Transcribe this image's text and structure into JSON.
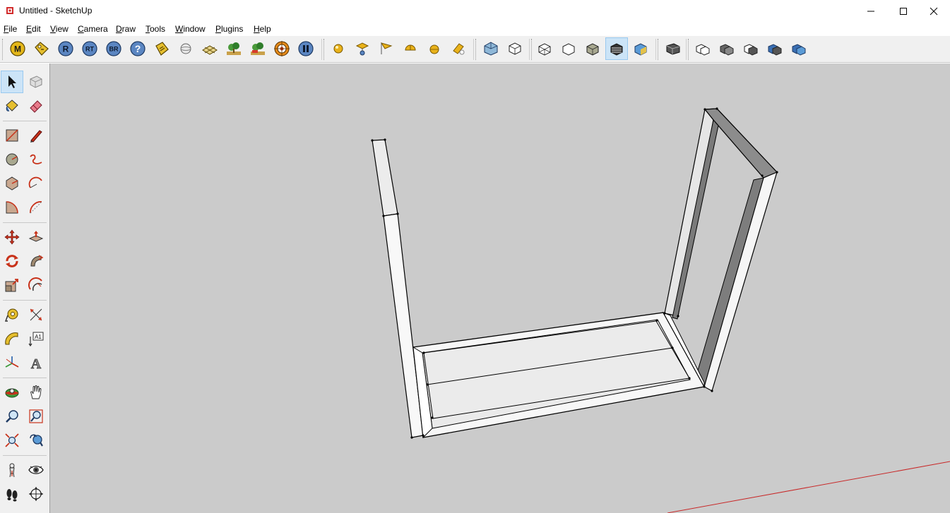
{
  "window": {
    "title": "Untitled - SketchUp",
    "controls": [
      "minimize-icon",
      "maximize-icon",
      "close-icon"
    ]
  },
  "menu": {
    "items": [
      {
        "label": "File",
        "mnemonic": "F"
      },
      {
        "label": "Edit",
        "mnemonic": "E"
      },
      {
        "label": "View",
        "mnemonic": "V"
      },
      {
        "label": "Camera",
        "mnemonic": "C"
      },
      {
        "label": "Draw",
        "mnemonic": "D"
      },
      {
        "label": "Tools",
        "mnemonic": "T"
      },
      {
        "label": "Window",
        "mnemonic": "W"
      },
      {
        "label": "Plugins",
        "mnemonic": "P"
      },
      {
        "label": "Help",
        "mnemonic": "H"
      }
    ]
  },
  "toolbar": {
    "plugin_buttons": [
      {
        "name": "plugin-m-icon",
        "glyph": "M"
      },
      {
        "name": "plugin-tag-icon",
        "glyph": ""
      },
      {
        "name": "plugin-r-icon",
        "glyph": "R"
      },
      {
        "name": "plugin-rt-icon",
        "glyph": "RT"
      },
      {
        "name": "plugin-br-icon",
        "glyph": "BR"
      },
      {
        "name": "plugin-help-icon",
        "glyph": "?"
      },
      {
        "name": "plugin-label-icon",
        "glyph": ""
      },
      {
        "name": "plugin-sphere-icon",
        "glyph": ""
      },
      {
        "name": "plugin-plane-icon",
        "glyph": ""
      },
      {
        "name": "plugin-tree-icon",
        "glyph": ""
      },
      {
        "name": "plugin-tree-red-icon",
        "glyph": ""
      },
      {
        "name": "plugin-target-icon",
        "glyph": ""
      },
      {
        "name": "plugin-pause-icon",
        "glyph": ""
      }
    ],
    "light_buttons": [
      "omni-light-icon",
      "spot-light-icon",
      "area-light-icon",
      "half-sphere-light-icon",
      "sphere-light-icon",
      "light-wand-icon"
    ],
    "view_buttons": [
      "iso-view-icon",
      "top-view-icon"
    ],
    "style_buttons": [
      {
        "name": "xray-style-icon",
        "active": false
      },
      {
        "name": "wireframe-style-icon",
        "active": false
      },
      {
        "name": "hidden-line-style-icon",
        "active": false
      },
      {
        "name": "shaded-style-icon",
        "active": false
      },
      {
        "name": "shaded-textures-style-icon",
        "active": true
      },
      {
        "name": "monochrome-style-icon",
        "active": false
      }
    ],
    "component_buttons": [
      "make-component-icon"
    ],
    "solid_buttons": [
      "outer-shell-icon",
      "intersect-icon",
      "union-icon",
      "subtract-icon",
      "trim-icon",
      "split-icon"
    ]
  },
  "palette": {
    "tools": [
      {
        "name": "select-tool-icon",
        "active": true
      },
      {
        "name": "make-component-tool-icon",
        "active": false
      },
      {
        "name": "paint-bucket-tool-icon",
        "active": false
      },
      {
        "name": "eraser-tool-icon",
        "active": false
      },
      {
        "name": "rectangle-tool-icon",
        "active": false
      },
      {
        "name": "line-tool-icon",
        "active": false
      },
      {
        "name": "circle-tool-icon",
        "active": false
      },
      {
        "name": "freehand-tool-icon",
        "active": false
      },
      {
        "name": "polygon-tool-icon",
        "active": false
      },
      {
        "name": "arc-tool-icon",
        "active": false
      },
      {
        "name": "pie-tool-icon",
        "active": false
      },
      {
        "name": "three-point-arc-tool-icon",
        "active": false
      },
      {
        "name": "move-tool-icon",
        "active": false
      },
      {
        "name": "push-pull-tool-icon",
        "active": false
      },
      {
        "name": "rotate-tool-icon",
        "active": false
      },
      {
        "name": "follow-me-tool-icon",
        "active": false
      },
      {
        "name": "scale-tool-icon",
        "active": false
      },
      {
        "name": "offset-tool-icon",
        "active": false
      },
      {
        "name": "tape-measure-tool-icon",
        "active": false
      },
      {
        "name": "dimension-tool-icon",
        "active": false
      },
      {
        "name": "protractor-tool-icon",
        "active": false
      },
      {
        "name": "text-tool-icon",
        "active": false,
        "glyph": "A1"
      },
      {
        "name": "axes-tool-icon",
        "active": false
      },
      {
        "name": "3d-text-tool-icon",
        "active": false,
        "glyph": "A"
      },
      {
        "name": "orbit-tool-icon",
        "active": false
      },
      {
        "name": "pan-tool-icon",
        "active": false
      },
      {
        "name": "zoom-tool-icon",
        "active": false
      },
      {
        "name": "zoom-window-tool-icon",
        "active": false
      },
      {
        "name": "zoom-extents-tool-icon",
        "active": false
      },
      {
        "name": "previous-view-tool-icon",
        "active": false
      },
      {
        "name": "position-camera-tool-icon",
        "active": false
      },
      {
        "name": "look-around-tool-icon",
        "active": false
      },
      {
        "name": "walk-tool-icon",
        "active": false
      },
      {
        "name": "section-plane-tool-icon",
        "active": false
      }
    ]
  },
  "colors": {
    "viewport_bg": "#cbcbcb",
    "toolbar_bg": "#f0f0f0",
    "active_highlight": "#cce4f7",
    "model_face": "#f4f4f4",
    "model_shadow_face": "#8a8a8a",
    "model_edge": "#000000",
    "red_axis": "#c82828"
  }
}
